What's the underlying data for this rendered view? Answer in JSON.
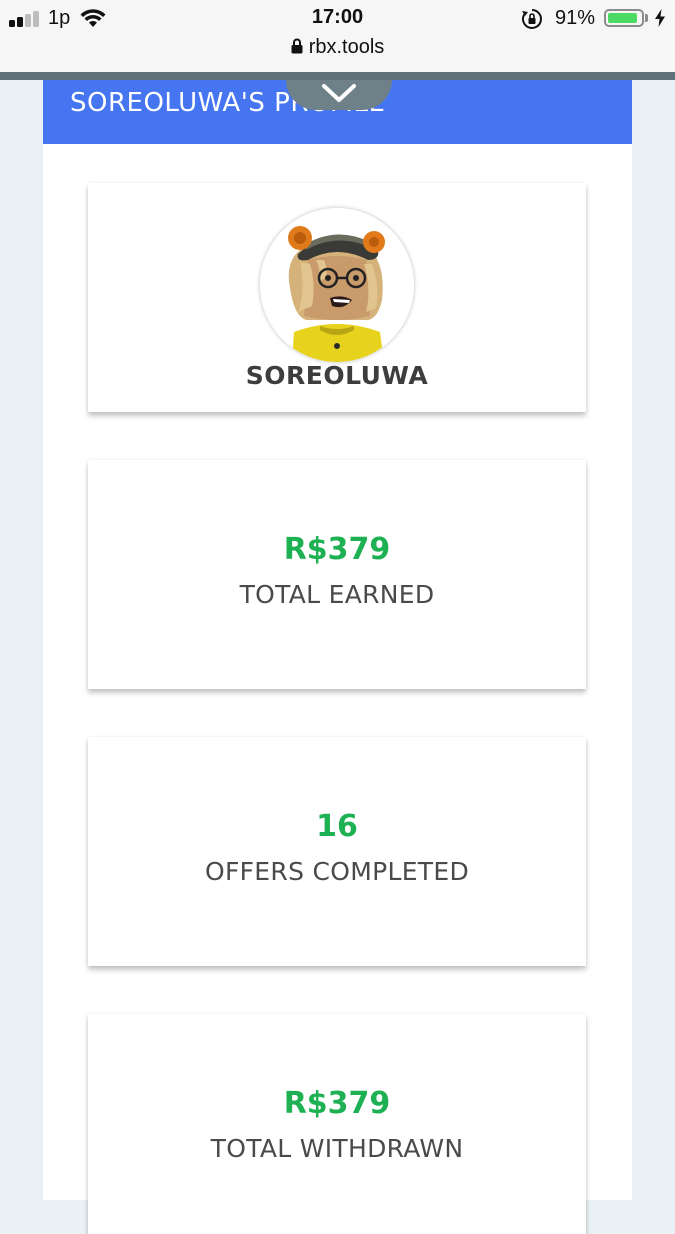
{
  "status_bar": {
    "carrier": "1p",
    "time": "17:00",
    "battery_percent": "91%",
    "battery_level": 0.91,
    "signal_bars_active": 2,
    "signal_bars_total": 4,
    "icons": [
      "signal-icon",
      "wifi-icon",
      "rotation-lock-icon",
      "battery-icon",
      "charging-icon"
    ]
  },
  "browser": {
    "url": "rbx.tools",
    "icons": [
      "lock-icon",
      "chevron-down-icon"
    ]
  },
  "header": {
    "title": "SOREOLUWA'S PROFILE"
  },
  "profile": {
    "username": "SOREOLUWA"
  },
  "stats": [
    {
      "value": "R$379",
      "label": "TOTAL EARNED"
    },
    {
      "value": "16",
      "label": "OFFERS COMPLETED"
    },
    {
      "value": "R$379",
      "label": "TOTAL WITHDRAWN"
    }
  ],
  "colors": {
    "header_bg": "#4575f0",
    "stat_value": "#1eb153",
    "battery_fill": "#4cd964",
    "page_bg": "#eaf1f5"
  }
}
